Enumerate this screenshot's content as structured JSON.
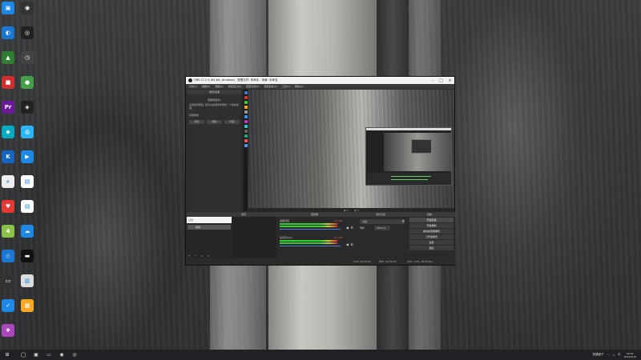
{
  "desktop": {
    "icons": [
      {
        "name": "app-icon-1",
        "label": "",
        "color": "#1e88e5",
        "glyph": "▣"
      },
      {
        "name": "app-icon-2",
        "label": "",
        "color": "#333333",
        "glyph": "◉"
      },
      {
        "name": "app-icon-3",
        "label": "",
        "color": "#1976d2",
        "glyph": "◐"
      },
      {
        "name": "app-icon-4",
        "label": "",
        "color": "#222222",
        "glyph": "◎"
      },
      {
        "name": "app-icon-5",
        "label": "",
        "color": "#2e7d32",
        "glyph": "▲"
      },
      {
        "name": "app-icon-6",
        "label": "",
        "color": "#444444",
        "glyph": "◷"
      },
      {
        "name": "app-icon-7",
        "label": "",
        "color": "#d32f2f",
        "glyph": "■"
      },
      {
        "name": "app-icon-8",
        "label": "",
        "color": "#43a047",
        "glyph": "●"
      },
      {
        "name": "app-icon-9",
        "label": "",
        "color": "#6a1b9a",
        "glyph": "Pr"
      },
      {
        "name": "app-icon-10",
        "label": "",
        "color": "#222222",
        "glyph": "◈"
      },
      {
        "name": "app-icon-11",
        "label": "",
        "color": "#00acc1",
        "glyph": "◆"
      },
      {
        "name": "app-icon-12",
        "label": "",
        "color": "#29b6f6",
        "glyph": "◍"
      },
      {
        "name": "app-icon-13",
        "label": "",
        "color": "#1565c0",
        "glyph": "K"
      },
      {
        "name": "app-icon-14",
        "label": "",
        "color": "#1e88e5",
        "glyph": "▶"
      },
      {
        "name": "app-icon-15",
        "label": "",
        "color": "#eeeeee",
        "glyph": "⌕"
      },
      {
        "name": "app-icon-16",
        "label": "",
        "color": "#ffffff",
        "glyph": "▤"
      },
      {
        "name": "app-icon-17",
        "label": "",
        "color": "#e53935",
        "glyph": "♥"
      },
      {
        "name": "app-icon-18",
        "label": "",
        "color": "#ffffff",
        "glyph": "▤"
      },
      {
        "name": "app-icon-19",
        "label": "",
        "color": "#8bc34a",
        "glyph": "4"
      },
      {
        "name": "app-icon-20",
        "label": "",
        "color": "#1e88e5",
        "glyph": "☁"
      },
      {
        "name": "app-icon-21",
        "label": "",
        "color": "#1976d2",
        "glyph": "◇"
      },
      {
        "name": "app-icon-22",
        "label": "",
        "color": "#111111",
        "glyph": "▬"
      },
      {
        "name": "app-icon-23",
        "label": "",
        "color": "#333333",
        "glyph": "▭"
      },
      {
        "name": "app-icon-24",
        "label": "",
        "color": "#dddddd",
        "glyph": "▥"
      },
      {
        "name": "app-icon-25",
        "label": "",
        "color": "#1e88e5",
        "glyph": "✓"
      },
      {
        "name": "app-icon-26",
        "label": "",
        "color": "#f9a825",
        "glyph": "▦"
      },
      {
        "name": "app-icon-27",
        "label": "",
        "color": "#ab47bc",
        "glyph": "❖"
      }
    ]
  },
  "obs": {
    "title": "OBS 27.2.4 (64-bit, windows) - 配置文件: 未命名 - 场景: 未命名",
    "menu": [
      "文件(F)",
      "编辑(E)",
      "视图(V)",
      "停靠窗口(D)",
      "配置文件(P)",
      "场景集合(S)",
      "工具(T)",
      "帮助(H)"
    ],
    "scene_panel": {
      "header": "场景/来源",
      "heading": "需要帮助吗?",
      "desc": "点击加号按钮, 就可以在场景中添加一个新的来源。",
      "sub": "获取帮助",
      "buttons": [
        "添加",
        "删除",
        "管理"
      ]
    },
    "mode_bar": [
      "◉ 0",
      "◐ 0"
    ],
    "dock_titles": {
      "scenes": "场景",
      "sources": "来源",
      "mixer": "混音器",
      "transitions": "场景过渡",
      "controls": "控制"
    },
    "filter_placeholder": "过滤",
    "scene_item": "场景",
    "mixer": [
      {
        "name": "桌面音频",
        "db": "0.0 dB"
      },
      {
        "name": "麦克风/Aux",
        "db": "0.0 dB"
      }
    ],
    "transitions": {
      "type": "淡出",
      "duration_label": "时长",
      "duration": "300 ms"
    },
    "controls": [
      "开始直播",
      "开始录制",
      "启动虚拟摄像机",
      "工作室模式",
      "设置",
      "退出"
    ],
    "status": {
      "live": "LIVE: 00:00:00",
      "rec": "REC: 00:00:00",
      "cpu": "CPU: 1.3%, 60.00 fps"
    }
  },
  "taskbar": {
    "icons": [
      "windows-start",
      "search",
      "task-view",
      "file-explorer",
      "browser",
      "app",
      "obs"
    ],
    "tray_text": "快捷键子",
    "time": "20:01",
    "date": "2022/4/10"
  }
}
